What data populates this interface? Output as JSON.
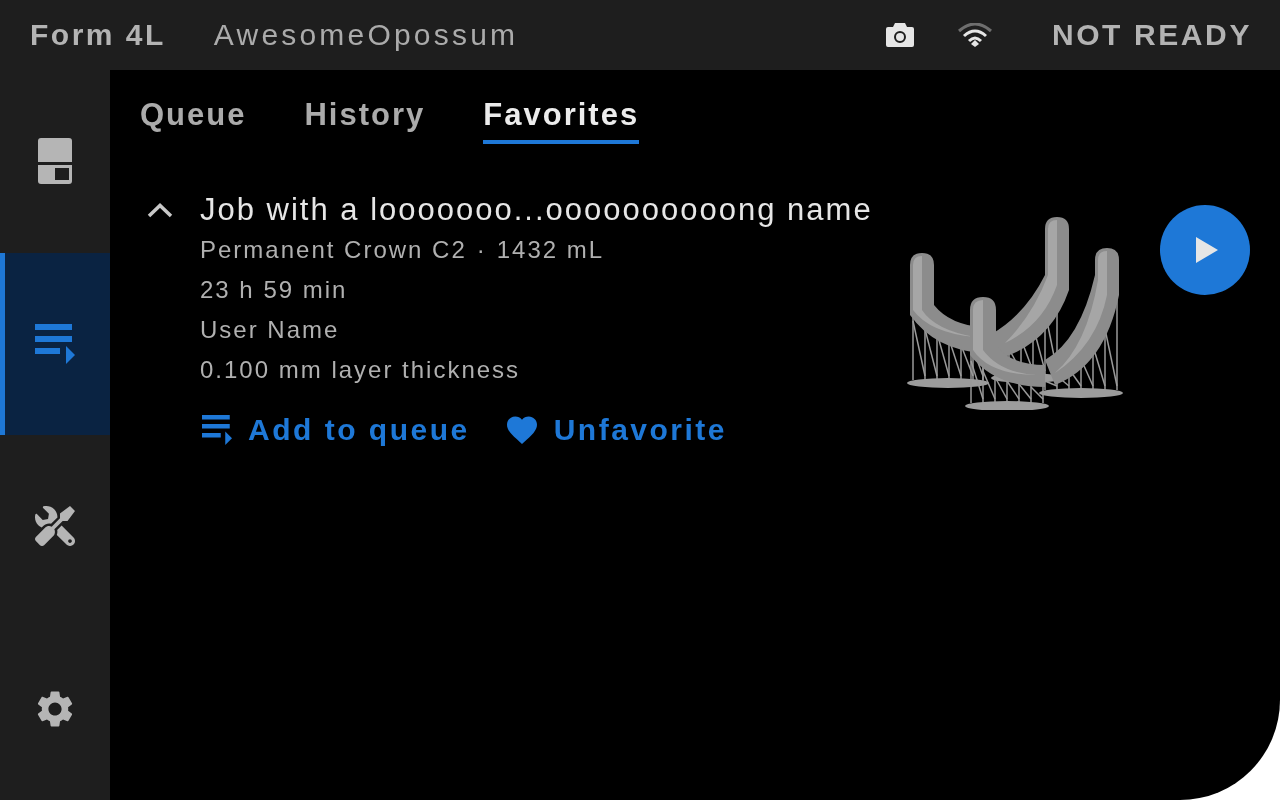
{
  "header": {
    "printer_model": "Form 4L",
    "printer_name": "AwesomeOpossum",
    "status": "NOT READY"
  },
  "sidebar": {
    "items": [
      {
        "kind": "printer",
        "selected": false
      },
      {
        "kind": "queue",
        "selected": true
      },
      {
        "kind": "tools",
        "selected": false
      },
      {
        "kind": "settings",
        "selected": false
      }
    ]
  },
  "tabs": [
    {
      "label": "Queue",
      "selected": false
    },
    {
      "label": "History",
      "selected": false
    },
    {
      "label": "Favorites",
      "selected": true
    }
  ],
  "job": {
    "expanded": true,
    "title": "Job with a looooooo...oooooooooong name",
    "material": "Permanent Crown C2",
    "separator": "·",
    "volume": "1432 mL",
    "duration": "23 h 59 min",
    "user": "User Name",
    "layer_thickness": "0.100 mm layer thickness",
    "actions": [
      {
        "kind": "queue",
        "label": "Add to queue"
      },
      {
        "kind": "unfavorite",
        "label": "Unfavorite"
      }
    ]
  }
}
